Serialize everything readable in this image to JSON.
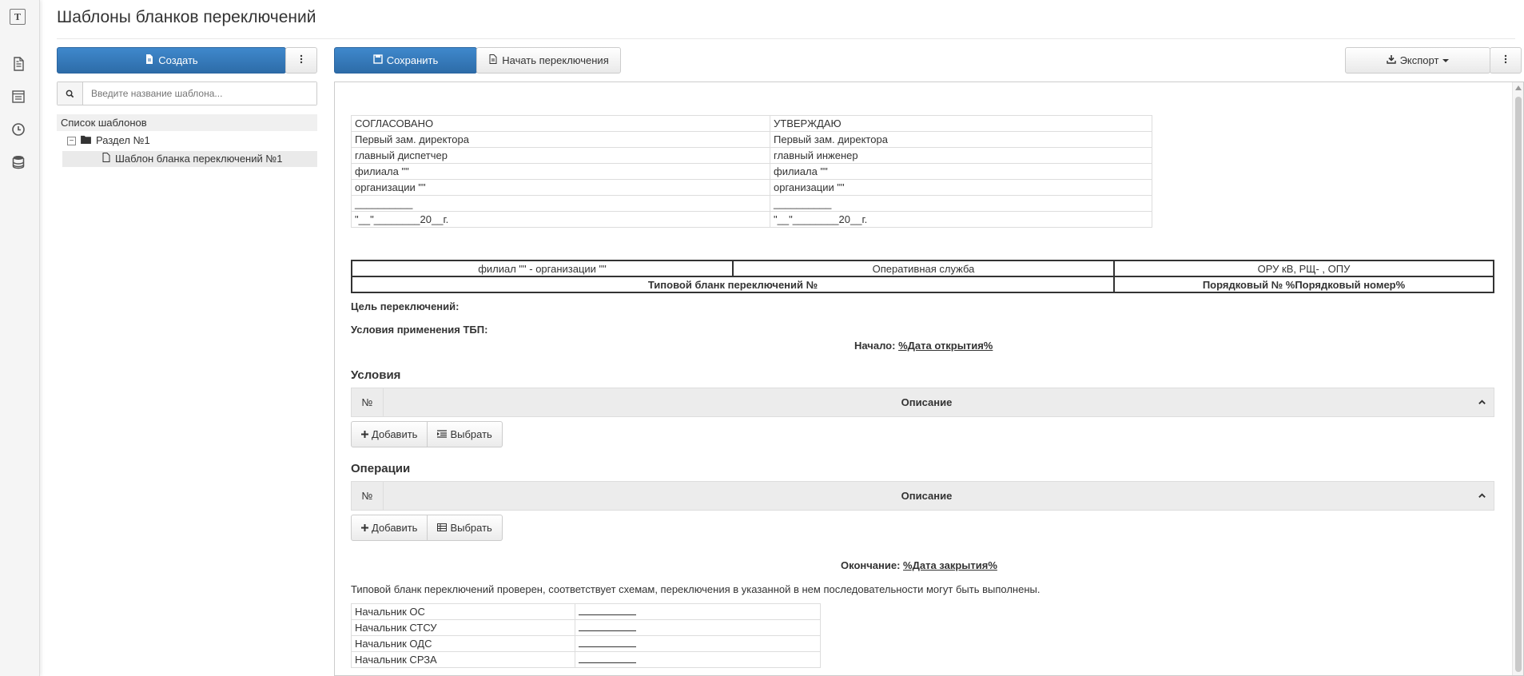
{
  "page": {
    "title": "Шаблоны бланков переключений"
  },
  "colors": {
    "primary": "#337ab7",
    "rail_bg": "#f5f5f5"
  },
  "rail": {
    "logo_letter": "T",
    "icons": [
      "document-icon",
      "checklist-icon",
      "clock-icon",
      "database-icon"
    ]
  },
  "left": {
    "create_label": "Создать",
    "search_placeholder": "Введите название шаблона...",
    "tree_header": "Список шаблонов",
    "section_label": "Раздел №1",
    "template_label": "Шаблон бланка переключений №1"
  },
  "toolbar": {
    "save_label": "Сохранить",
    "start_label": "Начать переключения",
    "export_label": "Экспорт"
  },
  "signatures": {
    "rows": [
      [
        "СОГЛАСОВАНО",
        "УТВЕРЖДАЮ"
      ],
      [
        "Первый зам. директора",
        "Первый зам. директора"
      ],
      [
        "главный диспетчер",
        "главный инженер"
      ],
      [
        "филиала \"\"",
        "филиала \"\""
      ],
      [
        "организации \"\"",
        "организации \"\""
      ],
      [
        "__________",
        "__________"
      ],
      [
        "\"__\"________20__г.",
        "\"__\"________20__г."
      ]
    ]
  },
  "header_table": {
    "r1c1": "филиал \"\" - организации \"\"",
    "r1c2": "Оперативная служба",
    "r1c3": "ОРУ     кВ, РЩ-     , ОПУ",
    "r2c1": "Типовой бланк переключений №",
    "r2c2": "Порядковый № %Порядковый номер%"
  },
  "goal_label": "Цель переключений:",
  "conditions_label": "Условия применения ТБП:",
  "start": {
    "label": "Начало:",
    "value": "%Дата открытия%"
  },
  "conditions": {
    "title": "Условия",
    "col_num": "№",
    "col_desc": "Описание",
    "add_label": "Добавить",
    "select_label": "Выбрать"
  },
  "operations": {
    "title": "Операции",
    "col_num": "№",
    "col_desc": "Описание",
    "add_label": "Добавить",
    "select_label": "Выбрать"
  },
  "end": {
    "label": "Окончание:",
    "value": "%Дата закрытия%"
  },
  "note": "Типовой бланк переключений проверен, соответствует схемам, переключения в указанной в нем последовательности могут быть выполнены.",
  "chiefs": [
    "Начальник ОС",
    "Начальник СТСУ",
    "Начальник ОДС",
    "Начальник СРЗА"
  ]
}
